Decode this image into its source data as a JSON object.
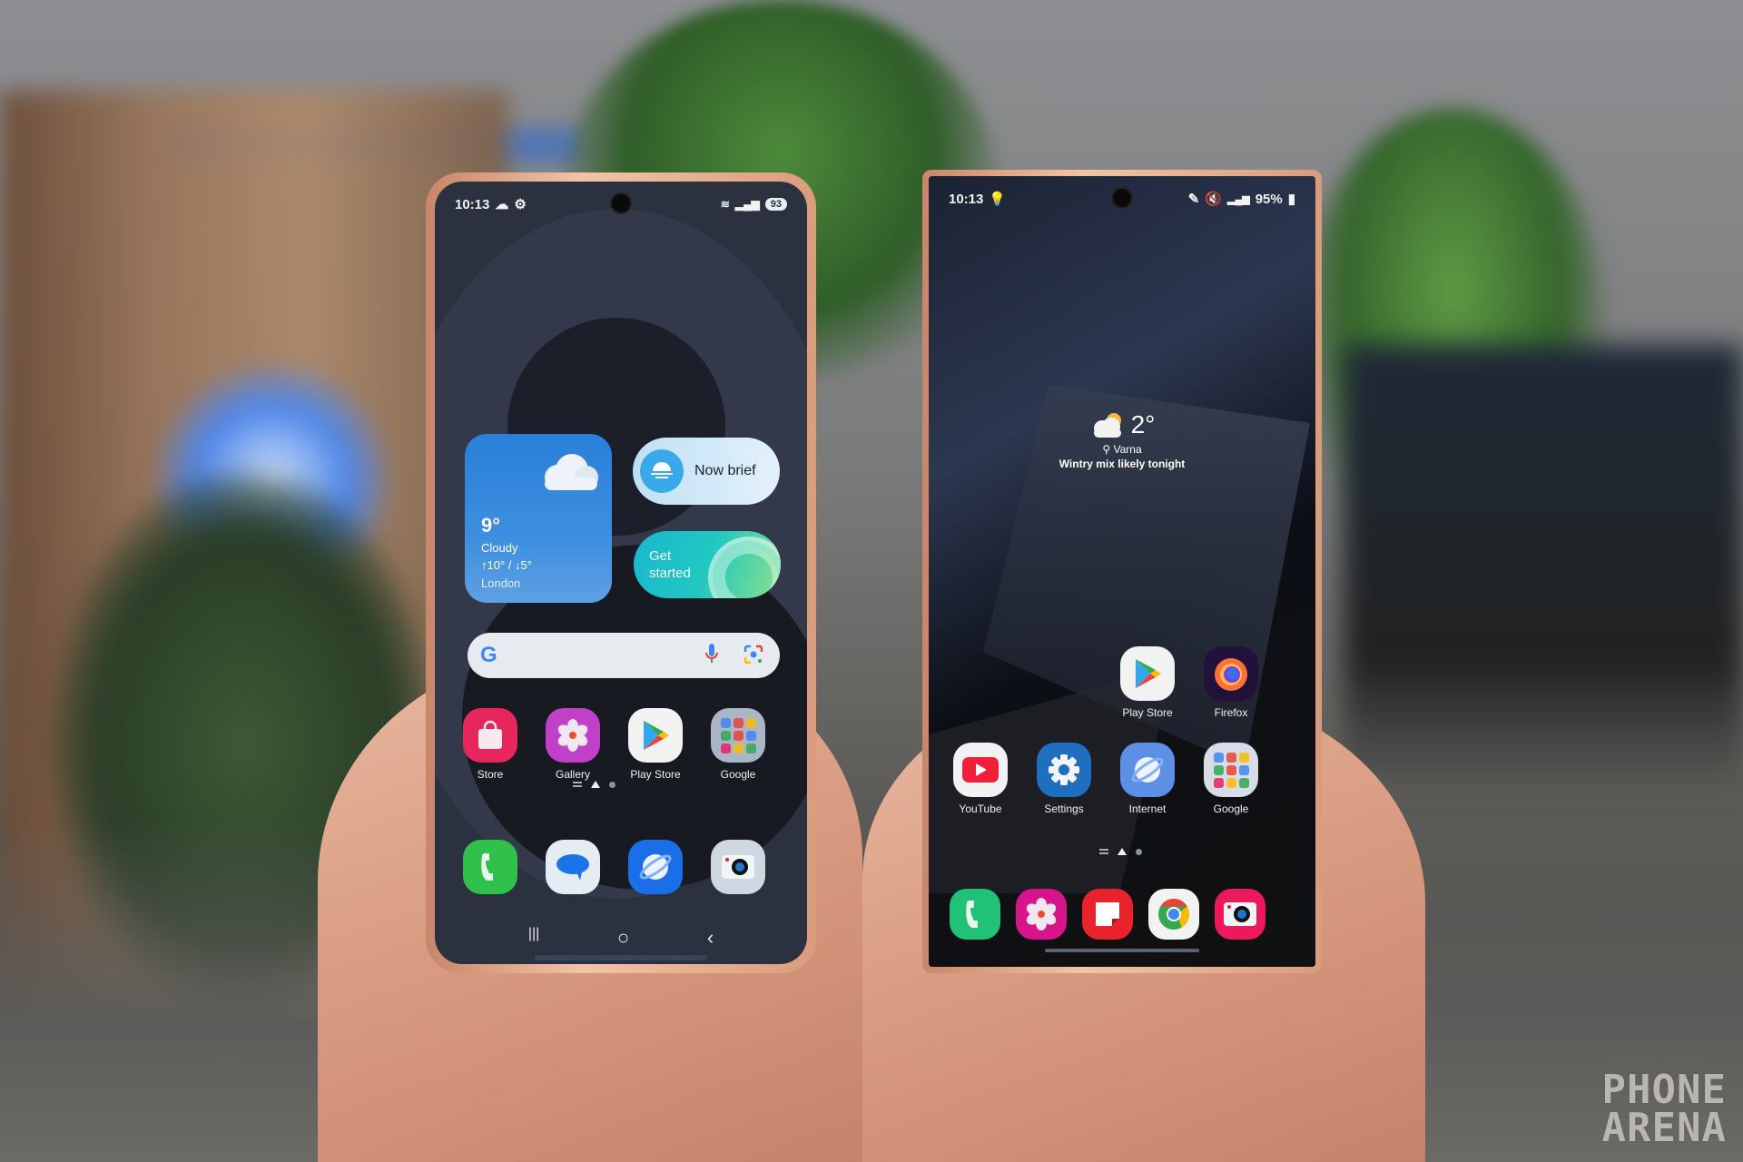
{
  "watermark": {
    "line1": "PHONE",
    "line2": "ARENA"
  },
  "left_phone": {
    "status": {
      "time": "10:13",
      "battery": "93"
    },
    "weather_widget": {
      "temp": "9°",
      "condition": "Cloudy",
      "range": "↑10° / ↓5°",
      "city": "London"
    },
    "now_brief": {
      "label": "Now brief"
    },
    "get_started": {
      "line1": "Get",
      "line2": "started"
    },
    "search": {
      "logo": "G"
    },
    "apps": [
      {
        "label": "Store",
        "icon": "shopping-bag-icon",
        "color": "#e8265e"
      },
      {
        "label": "Gallery",
        "icon": "flower-icon",
        "color": "#c040c8"
      },
      {
        "label": "Play Store",
        "icon": "play-store-icon",
        "color": "#f2f2f2"
      },
      {
        "label": "Google",
        "icon": "folder-icon",
        "color": "#aab6c8"
      }
    ],
    "dock": [
      {
        "name": "phone",
        "icon": "phone-icon",
        "color": "#2fc14a"
      },
      {
        "name": "messages",
        "icon": "messages-icon",
        "color": "#e6ecf4"
      },
      {
        "name": "internet",
        "icon": "internet-icon",
        "color": "#1a6fe8"
      },
      {
        "name": "camera",
        "icon": "camera-icon",
        "color": "#cfd8e2"
      }
    ],
    "nav": {
      "recents": "|||",
      "home": "○",
      "back": "‹"
    }
  },
  "right_phone": {
    "status": {
      "time": "10:13",
      "battery": "95%"
    },
    "weather": {
      "temp": "2°",
      "location": "Varna",
      "description": "Wintry mix likely tonight"
    },
    "apps_row1": [
      {
        "label": "Play Store",
        "icon": "play-store-icon",
        "color": "#f2f2f2"
      },
      {
        "label": "Firefox",
        "icon": "firefox-icon",
        "color": "#20123a"
      }
    ],
    "apps_row2": [
      {
        "label": "YouTube",
        "icon": "youtube-icon",
        "color": "#f2f2f2"
      },
      {
        "label": "Settings",
        "icon": "gear-icon",
        "color": "#1f6ec0"
      },
      {
        "label": "Internet",
        "icon": "internet-icon",
        "color": "#5d8fe6"
      },
      {
        "label": "Google",
        "icon": "folder-icon",
        "color": "#d6dde6"
      }
    ],
    "dock": [
      {
        "name": "phone",
        "icon": "phone-icon",
        "color": "#1fc277"
      },
      {
        "name": "gallery",
        "icon": "flower-icon",
        "color": "#d8148c"
      },
      {
        "name": "notes",
        "icon": "notes-icon",
        "color": "#e8232b"
      },
      {
        "name": "chrome",
        "icon": "chrome-icon",
        "color": "#f2f2f2"
      },
      {
        "name": "camera",
        "icon": "camera-icon",
        "color": "#ec1a5c"
      }
    ]
  }
}
